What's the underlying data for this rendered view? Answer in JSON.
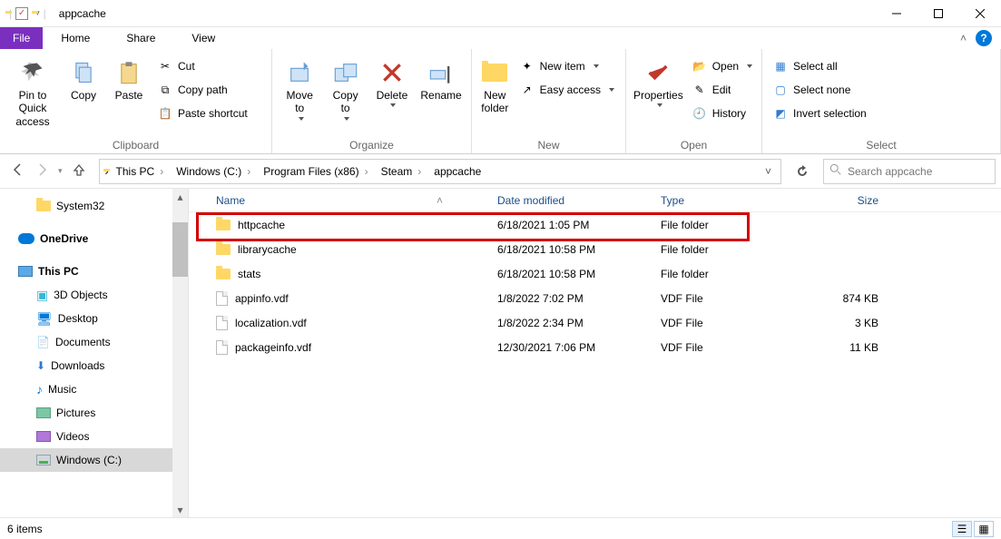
{
  "title": "appcache",
  "tabs": {
    "file": "File",
    "home": "Home",
    "share": "Share",
    "view": "View"
  },
  "ribbon": {
    "clipboard": {
      "label": "Clipboard",
      "pin": "Pin to Quick\naccess",
      "copy": "Copy",
      "paste": "Paste",
      "cut": "Cut",
      "copypath": "Copy path",
      "pasteshortcut": "Paste shortcut"
    },
    "organize": {
      "label": "Organize",
      "moveto": "Move\nto",
      "copyto": "Copy\nto",
      "delete": "Delete",
      "rename": "Rename"
    },
    "new": {
      "label": "New",
      "newfolder": "New\nfolder",
      "newitem": "New item",
      "easyaccess": "Easy access"
    },
    "open": {
      "label": "Open",
      "properties": "Properties",
      "open": "Open",
      "edit": "Edit",
      "history": "History"
    },
    "select": {
      "label": "Select",
      "selectall": "Select all",
      "selectnone": "Select none",
      "invert": "Invert selection"
    }
  },
  "breadcrumb": [
    "This PC",
    "Windows (C:)",
    "Program Files (x86)",
    "Steam",
    "appcache"
  ],
  "search_placeholder": "Search appcache",
  "tree": {
    "system32": "System32",
    "onedrive": "OneDrive",
    "thispc": "This PC",
    "objects3d": "3D Objects",
    "desktop": "Desktop",
    "documents": "Documents",
    "downloads": "Downloads",
    "music": "Music",
    "pictures": "Pictures",
    "videos": "Videos",
    "windowsc": "Windows (C:)"
  },
  "columns": {
    "name": "Name",
    "date": "Date modified",
    "type": "Type",
    "size": "Size"
  },
  "rows": [
    {
      "name": "httpcache",
      "date": "6/18/2021 1:05 PM",
      "type": "File folder",
      "size": "",
      "icon": "folder"
    },
    {
      "name": "librarycache",
      "date": "6/18/2021 10:58 PM",
      "type": "File folder",
      "size": "",
      "icon": "folder"
    },
    {
      "name": "stats",
      "date": "6/18/2021 10:58 PM",
      "type": "File folder",
      "size": "",
      "icon": "folder"
    },
    {
      "name": "appinfo.vdf",
      "date": "1/8/2022 7:02 PM",
      "type": "VDF File",
      "size": "874 KB",
      "icon": "file"
    },
    {
      "name": "localization.vdf",
      "date": "1/8/2022 2:34 PM",
      "type": "VDF File",
      "size": "3 KB",
      "icon": "file"
    },
    {
      "name": "packageinfo.vdf",
      "date": "12/30/2021 7:06 PM",
      "type": "VDF File",
      "size": "11 KB",
      "icon": "file"
    }
  ],
  "status": "6 items"
}
